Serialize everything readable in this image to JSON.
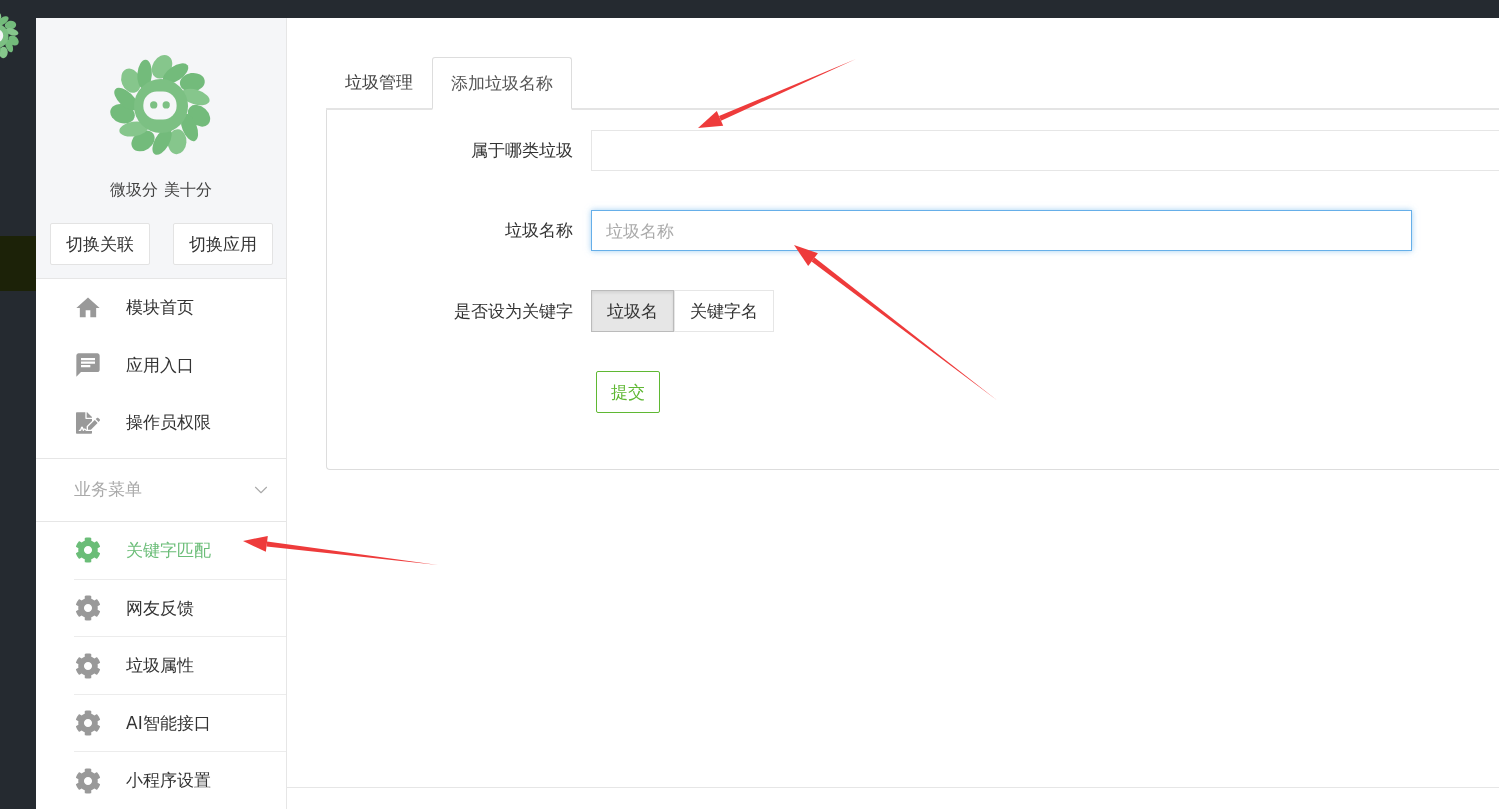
{
  "sidebar": {
    "brand": "微圾分 美十分",
    "buttons": [
      "切换关联",
      "切换应用"
    ],
    "menu": [
      {
        "label": "模块首页",
        "kind": "home"
      },
      {
        "label": "应用入口",
        "kind": "chat"
      },
      {
        "label": "操作员权限",
        "kind": "document"
      }
    ],
    "group": {
      "label": "业务菜单",
      "expanded": true,
      "items": [
        {
          "label": "关键字匹配",
          "selected": true
        },
        {
          "label": "网友反馈",
          "selected": false
        },
        {
          "label": "垃圾属性",
          "selected": false
        },
        {
          "label": "AI智能接口",
          "selected": false
        },
        {
          "label": "小程序设置",
          "selected": false
        }
      ]
    }
  },
  "tabs": [
    {
      "label": "垃圾管理",
      "selected": false
    },
    {
      "label": "添加垃圾名称",
      "selected": true
    }
  ],
  "form": {
    "fields": [
      {
        "kind": "text",
        "label": "属于哪类垃圾",
        "focused": false,
        "wide": true
      },
      {
        "kind": "text",
        "label": "垃圾名称",
        "placeholder": "垃圾名称",
        "focused": true,
        "wide": false
      },
      {
        "kind": "toggle",
        "label": "是否设为关键字",
        "options": [
          {
            "label": "垃圾名",
            "selected": true
          },
          {
            "label": "关键字名",
            "selected": false
          }
        ]
      }
    ],
    "submit": "提交"
  }
}
